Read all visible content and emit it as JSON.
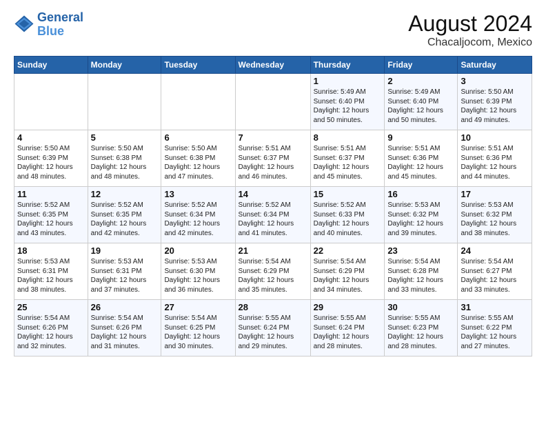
{
  "header": {
    "logo_line1": "General",
    "logo_line2": "Blue",
    "main_title": "August 2024",
    "subtitle": "Chacaljocom, Mexico"
  },
  "calendar": {
    "days_of_week": [
      "Sunday",
      "Monday",
      "Tuesday",
      "Wednesday",
      "Thursday",
      "Friday",
      "Saturday"
    ],
    "weeks": [
      [
        {
          "day": "",
          "info": ""
        },
        {
          "day": "",
          "info": ""
        },
        {
          "day": "",
          "info": ""
        },
        {
          "day": "",
          "info": ""
        },
        {
          "day": "1",
          "info": "Sunrise: 5:49 AM\nSunset: 6:40 PM\nDaylight: 12 hours\nand 50 minutes."
        },
        {
          "day": "2",
          "info": "Sunrise: 5:49 AM\nSunset: 6:40 PM\nDaylight: 12 hours\nand 50 minutes."
        },
        {
          "day": "3",
          "info": "Sunrise: 5:50 AM\nSunset: 6:39 PM\nDaylight: 12 hours\nand 49 minutes."
        }
      ],
      [
        {
          "day": "4",
          "info": "Sunrise: 5:50 AM\nSunset: 6:39 PM\nDaylight: 12 hours\nand 48 minutes."
        },
        {
          "day": "5",
          "info": "Sunrise: 5:50 AM\nSunset: 6:38 PM\nDaylight: 12 hours\nand 48 minutes."
        },
        {
          "day": "6",
          "info": "Sunrise: 5:50 AM\nSunset: 6:38 PM\nDaylight: 12 hours\nand 47 minutes."
        },
        {
          "day": "7",
          "info": "Sunrise: 5:51 AM\nSunset: 6:37 PM\nDaylight: 12 hours\nand 46 minutes."
        },
        {
          "day": "8",
          "info": "Sunrise: 5:51 AM\nSunset: 6:37 PM\nDaylight: 12 hours\nand 45 minutes."
        },
        {
          "day": "9",
          "info": "Sunrise: 5:51 AM\nSunset: 6:36 PM\nDaylight: 12 hours\nand 45 minutes."
        },
        {
          "day": "10",
          "info": "Sunrise: 5:51 AM\nSunset: 6:36 PM\nDaylight: 12 hours\nand 44 minutes."
        }
      ],
      [
        {
          "day": "11",
          "info": "Sunrise: 5:52 AM\nSunset: 6:35 PM\nDaylight: 12 hours\nand 43 minutes."
        },
        {
          "day": "12",
          "info": "Sunrise: 5:52 AM\nSunset: 6:35 PM\nDaylight: 12 hours\nand 42 minutes."
        },
        {
          "day": "13",
          "info": "Sunrise: 5:52 AM\nSunset: 6:34 PM\nDaylight: 12 hours\nand 42 minutes."
        },
        {
          "day": "14",
          "info": "Sunrise: 5:52 AM\nSunset: 6:34 PM\nDaylight: 12 hours\nand 41 minutes."
        },
        {
          "day": "15",
          "info": "Sunrise: 5:52 AM\nSunset: 6:33 PM\nDaylight: 12 hours\nand 40 minutes."
        },
        {
          "day": "16",
          "info": "Sunrise: 5:53 AM\nSunset: 6:32 PM\nDaylight: 12 hours\nand 39 minutes."
        },
        {
          "day": "17",
          "info": "Sunrise: 5:53 AM\nSunset: 6:32 PM\nDaylight: 12 hours\nand 38 minutes."
        }
      ],
      [
        {
          "day": "18",
          "info": "Sunrise: 5:53 AM\nSunset: 6:31 PM\nDaylight: 12 hours\nand 38 minutes."
        },
        {
          "day": "19",
          "info": "Sunrise: 5:53 AM\nSunset: 6:31 PM\nDaylight: 12 hours\nand 37 minutes."
        },
        {
          "day": "20",
          "info": "Sunrise: 5:53 AM\nSunset: 6:30 PM\nDaylight: 12 hours\nand 36 minutes."
        },
        {
          "day": "21",
          "info": "Sunrise: 5:54 AM\nSunset: 6:29 PM\nDaylight: 12 hours\nand 35 minutes."
        },
        {
          "day": "22",
          "info": "Sunrise: 5:54 AM\nSunset: 6:29 PM\nDaylight: 12 hours\nand 34 minutes."
        },
        {
          "day": "23",
          "info": "Sunrise: 5:54 AM\nSunset: 6:28 PM\nDaylight: 12 hours\nand 33 minutes."
        },
        {
          "day": "24",
          "info": "Sunrise: 5:54 AM\nSunset: 6:27 PM\nDaylight: 12 hours\nand 33 minutes."
        }
      ],
      [
        {
          "day": "25",
          "info": "Sunrise: 5:54 AM\nSunset: 6:26 PM\nDaylight: 12 hours\nand 32 minutes."
        },
        {
          "day": "26",
          "info": "Sunrise: 5:54 AM\nSunset: 6:26 PM\nDaylight: 12 hours\nand 31 minutes."
        },
        {
          "day": "27",
          "info": "Sunrise: 5:54 AM\nSunset: 6:25 PM\nDaylight: 12 hours\nand 30 minutes."
        },
        {
          "day": "28",
          "info": "Sunrise: 5:55 AM\nSunset: 6:24 PM\nDaylight: 12 hours\nand 29 minutes."
        },
        {
          "day": "29",
          "info": "Sunrise: 5:55 AM\nSunset: 6:24 PM\nDaylight: 12 hours\nand 28 minutes."
        },
        {
          "day": "30",
          "info": "Sunrise: 5:55 AM\nSunset: 6:23 PM\nDaylight: 12 hours\nand 28 minutes."
        },
        {
          "day": "31",
          "info": "Sunrise: 5:55 AM\nSunset: 6:22 PM\nDaylight: 12 hours\nand 27 minutes."
        }
      ]
    ]
  }
}
